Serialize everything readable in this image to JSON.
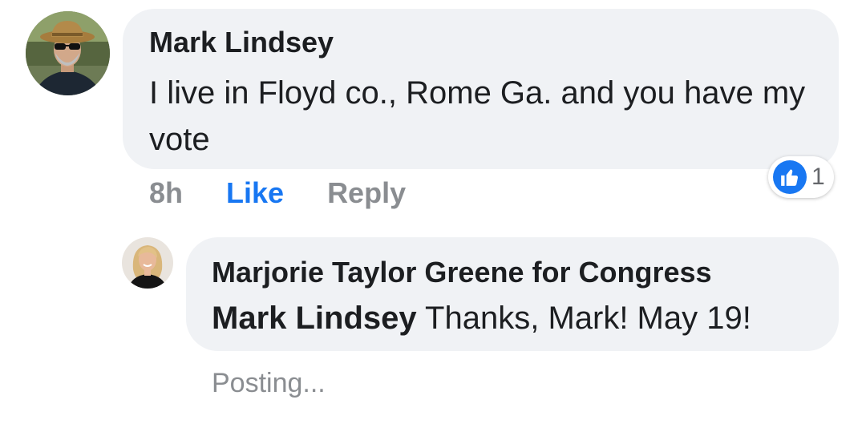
{
  "comment": {
    "author": "Mark Lindsey",
    "text": "I live in Floyd co., Rome Ga. and you have my vote",
    "timestamp": "8h",
    "like_label": "Like",
    "reply_label": "Reply",
    "reactions": {
      "icon": "thumbs-up-icon",
      "count": "1"
    }
  },
  "reply": {
    "author": "Marjorie Taylor Greene for Congress",
    "mention": "Mark Lindsey",
    "text": " Thanks, Mark! May 19!",
    "status": "Posting..."
  },
  "colors": {
    "bubble": "#f0f2f5",
    "like_blue": "#1877f2",
    "muted": "#8a8d91",
    "text": "#1c1e21"
  }
}
